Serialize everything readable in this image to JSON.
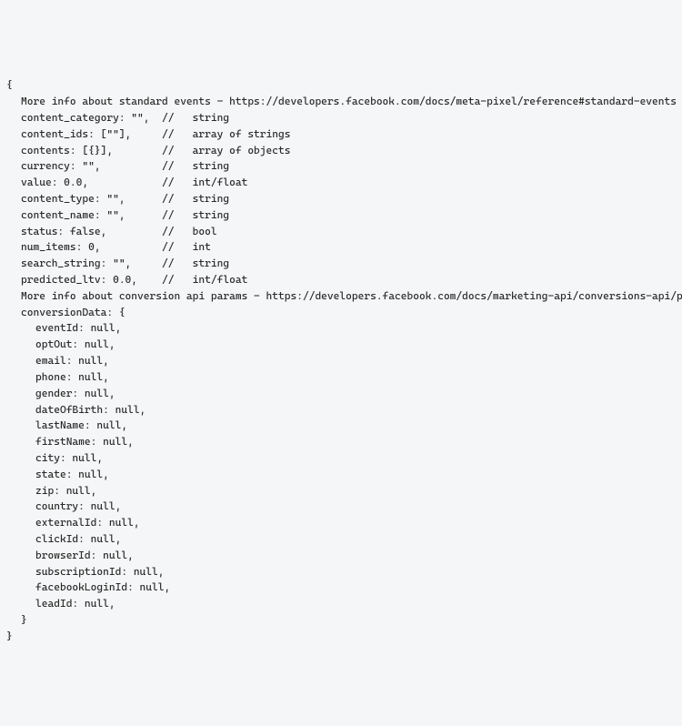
{
  "code": {
    "open_brace": "{",
    "info1_prefix": "More info about standard events - ",
    "info1_url": "https://developers.facebook.com/docs/meta-pixel/reference#standard-events",
    "props": [
      {
        "key": "content_category",
        "value": "\"\"",
        "comment": "string"
      },
      {
        "key": "content_ids",
        "value": "[\"\"]",
        "comment": "array of strings"
      },
      {
        "key": "contents",
        "value": "[{}]",
        "comment": "array of objects"
      },
      {
        "key": "currency",
        "value": "\"\"",
        "comment": "string"
      },
      {
        "key": "value",
        "value": "0.0",
        "comment": "int/float"
      },
      {
        "key": "content_type",
        "value": "\"\"",
        "comment": "string"
      },
      {
        "key": "content_name",
        "value": "\"\"",
        "comment": "string"
      },
      {
        "key": "status",
        "value": "false",
        "comment": "bool"
      },
      {
        "key": "num_items",
        "value": "0",
        "comment": "int"
      },
      {
        "key": "search_string",
        "value": "\"\"",
        "comment": "string"
      },
      {
        "key": "predicted_ltv",
        "value": "0.0",
        "comment": "int/float"
      }
    ],
    "info2_prefix": "More info about conversion api params - ",
    "info2_url": "https://developers.facebook.com/docs/marketing-api/conversions-api/parameters/customer-information-parameters",
    "conv_open": "conversionData: {",
    "conv_props": [
      "eventId",
      "optOut",
      "email",
      "phone",
      "gender",
      "dateOfBirth",
      "lastName",
      "firstName",
      "city",
      "state",
      "zip",
      "country",
      "externalId",
      "clickId",
      "browserId",
      "subscriptionId",
      "facebookLoginId",
      "leadId"
    ],
    "conv_close": "}",
    "close_brace": "}",
    "comment_col": 23,
    "type_col": 28
  }
}
